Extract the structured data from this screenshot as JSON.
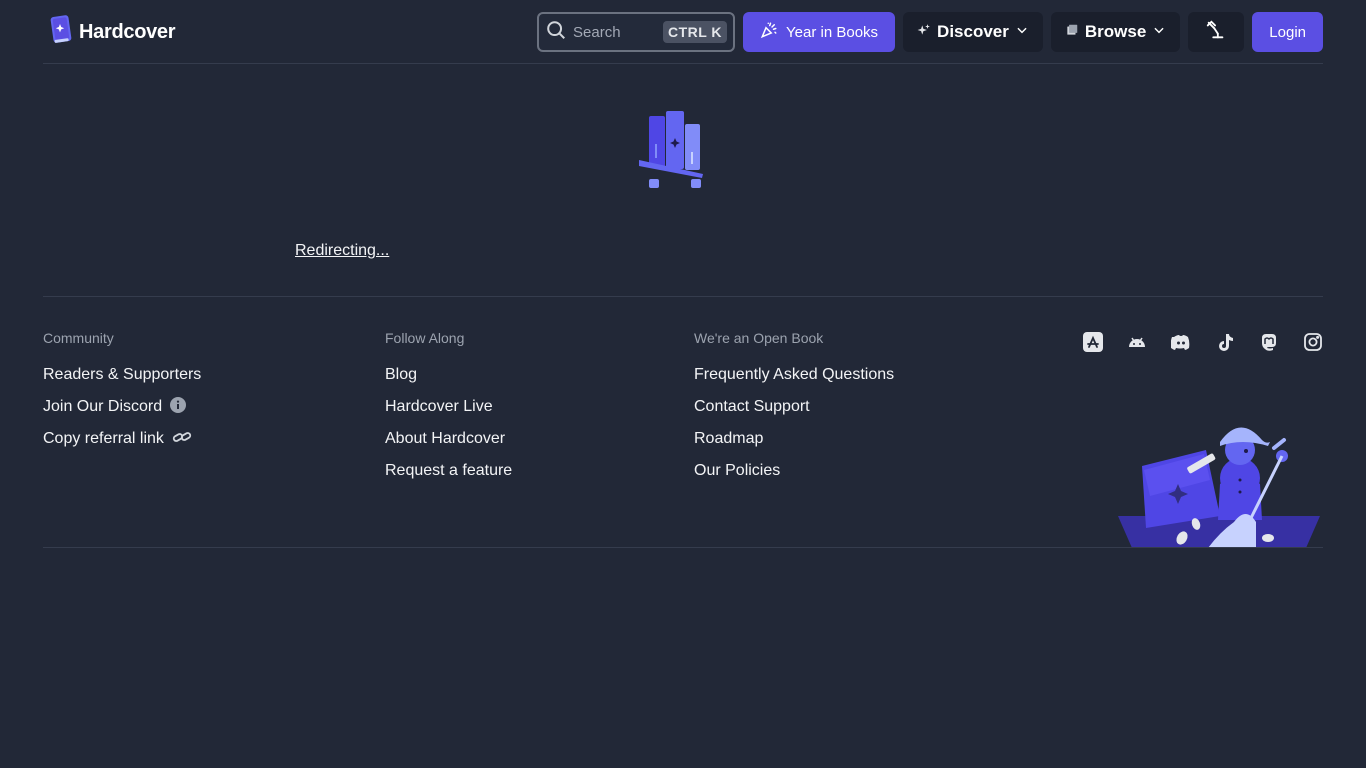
{
  "header": {
    "brand": "Hardcover",
    "search": {
      "placeholder": "Search",
      "shortcut": "CTRL K"
    },
    "year_in_books": "Year in Books",
    "discover": "Discover",
    "browse": "Browse",
    "login": "Login"
  },
  "main": {
    "status": "Redirecting..."
  },
  "footer": {
    "community": {
      "heading": "Community",
      "links": [
        "Readers & Supporters",
        "Join Our Discord",
        "Copy referral link"
      ]
    },
    "follow": {
      "heading": "Follow Along",
      "links": [
        "Blog",
        "Hardcover Live",
        "About Hardcover",
        "Request a feature"
      ]
    },
    "open_book": {
      "heading": "We're an Open Book",
      "links": [
        "Frequently Asked Questions",
        "Contact Support",
        "Roadmap",
        "Our Policies"
      ]
    },
    "socials": [
      "app-store-icon",
      "android-icon",
      "discord-icon",
      "tiktok-icon",
      "mastodon-icon",
      "instagram-icon"
    ]
  },
  "colors": {
    "background": "#222837",
    "accent": "#5b4fe3",
    "divider": "#353c4d"
  }
}
